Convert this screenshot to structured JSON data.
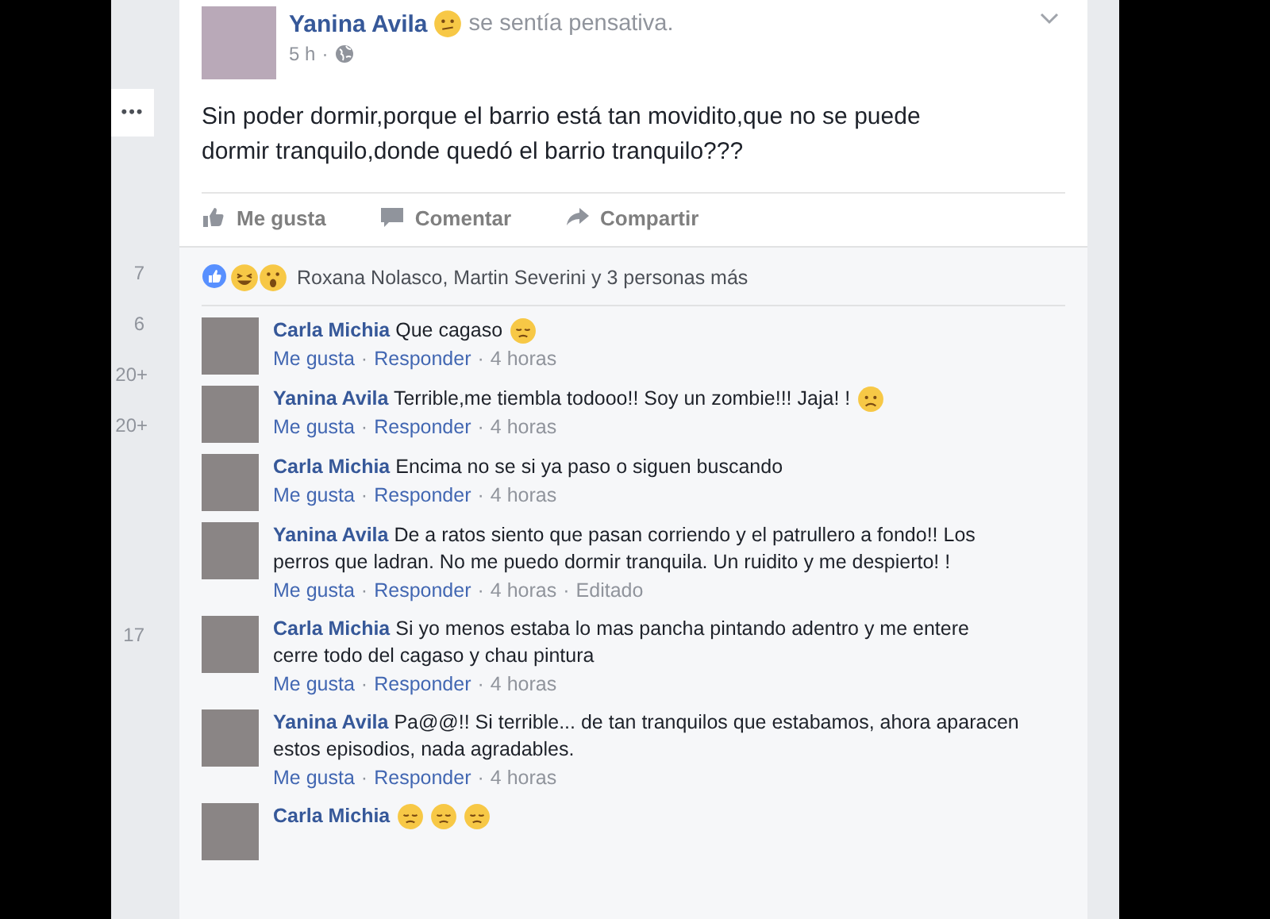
{
  "gutter": {
    "more": "•••",
    "counts": [
      "7",
      "6",
      "20+",
      "20+",
      "17"
    ]
  },
  "post": {
    "author": "Yanina Avila",
    "feeling": "se sentía pensativa.",
    "time": "5 h",
    "separator": "·",
    "text": "Sin poder dormir,porque el barrio está tan movidito,que no se puede dormir tranquilo,donde quedó el barrio tranquilo???",
    "actions": [
      {
        "kind": "like",
        "label": "Me gusta"
      },
      {
        "kind": "comment",
        "label": "Comentar"
      },
      {
        "kind": "share",
        "label": "Compartir"
      }
    ],
    "reactions": {
      "icons": [
        {
          "kind": "like"
        },
        {
          "kind": "haha"
        },
        {
          "kind": "wow"
        }
      ],
      "summary": "Roxana Nolasco, Martin Severini y 3 personas más"
    }
  },
  "comments": [
    {
      "author": "Carla Michia",
      "text": "Que cagaso",
      "emoji": [
        {
          "kind": "sad"
        }
      ],
      "links": [
        "Me gusta",
        "Responder"
      ],
      "time": "4 horas"
    },
    {
      "author": "Yanina Avila",
      "text": "Terrible,me tiembla todooo!! Soy un zombie!!! Jaja! !",
      "emoji": [
        {
          "kind": "worried"
        }
      ],
      "links": [
        "Me gusta",
        "Responder"
      ],
      "time": "4 horas"
    },
    {
      "author": "Carla Michia",
      "text": "Encima no se si ya paso o siguen buscando",
      "links": [
        "Me gusta",
        "Responder"
      ],
      "time": "4 horas"
    },
    {
      "author": "Yanina Avila",
      "text": "De a ratos siento que pasan corriendo y el patrullero a fondo!! Los perros que ladran. No me puedo dormir tranquila. Un ruidito y me despierto! !",
      "links": [
        "Me gusta",
        "Responder"
      ],
      "time": "4 horas",
      "edited": "Editado"
    },
    {
      "author": "Carla Michia",
      "text": "Si yo menos estaba lo mas pancha pintando adentro y me entere cerre todo del cagaso y chau pintura",
      "links": [
        "Me gusta",
        "Responder"
      ],
      "time": "4 horas"
    },
    {
      "author": "Yanina Avila",
      "text": "Pa@@!! Si terrible... de tan tranquilos que estabamos, ahora aparacen estos episodios, nada agradables.",
      "links": [
        "Me gusta",
        "Responder"
      ],
      "time": "4 horas"
    },
    {
      "author": "Carla Michia",
      "emoji": [
        {
          "kind": "sad"
        },
        {
          "kind": "sad"
        },
        {
          "kind": "sad"
        }
      ]
    }
  ]
}
